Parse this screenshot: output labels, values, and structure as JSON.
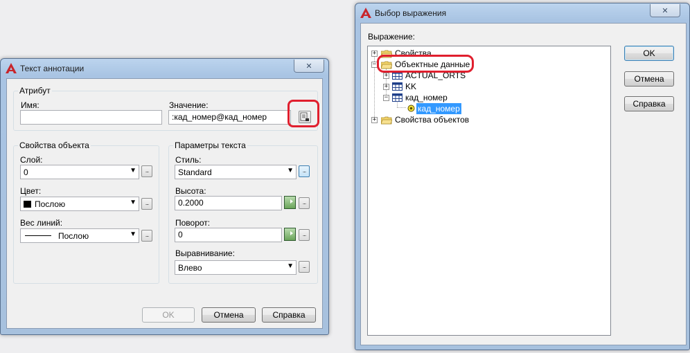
{
  "annotation_dialog": {
    "title": "Текст аннотации",
    "attribute_group": "Атрибут",
    "name_label": "Имя:",
    "name_value": "",
    "value_label": "Значение:",
    "value_value": ":кад_номер@кад_номер",
    "object_props_group": "Свойства объекта",
    "layer_label": "Слой:",
    "layer_value": "0",
    "color_label": "Цвет:",
    "color_value": "Послою",
    "lineweight_label": "Вес линий:",
    "lineweight_value": "Послою",
    "text_params_group": "Параметры текста",
    "style_label": "Стиль:",
    "style_value": "Standard",
    "height_label": "Высота:",
    "height_value": "0.2000",
    "rotation_label": "Поворот:",
    "rotation_value": "0",
    "justify_label": "Выравнивание:",
    "justify_value": "Влево",
    "ok_label": "OK",
    "cancel_label": "Отмена",
    "help_label": "Справка",
    "close_glyph": "✕",
    "ellipsis": "...",
    "color_swatch": "#000000",
    "highlight_color": "#e01f2e"
  },
  "expression_dialog": {
    "title": "Выбор выражения",
    "expression_label": "Выражение:",
    "tree": {
      "properties": "Свойства",
      "object_data": "Объектные данные",
      "actual_orts": "ACTUAL_ORTS",
      "kk": "KK",
      "kad_nomer_table": "кад_номер",
      "kad_nomer_field": "кад_номер",
      "object_properties": "Свойства объектов"
    },
    "ok_label": "OK",
    "cancel_label": "Отмена",
    "help_label": "Справка",
    "close_glyph": "✕",
    "selection_color": "#3399ff"
  }
}
